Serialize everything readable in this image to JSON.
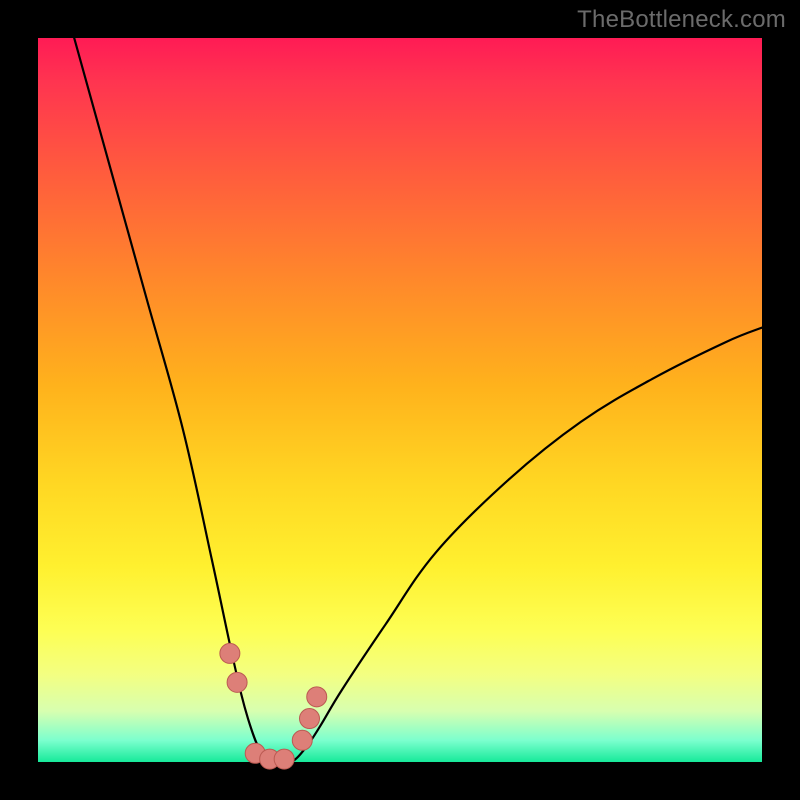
{
  "watermark": "TheBottleneck.com",
  "colors": {
    "background": "#000000",
    "curve": "#000000",
    "marker_fill": "#dd7f78",
    "marker_stroke": "#bb5a52"
  },
  "chart_data": {
    "type": "line",
    "title": "",
    "xlabel": "",
    "ylabel": "",
    "xlim": [
      0,
      100
    ],
    "ylim": [
      0,
      100
    ],
    "grid": false,
    "legend": false,
    "note": "V-shaped bottleneck curve. x = performance-ratio position (arbitrary 0–100). y = bottleneck percentage (0 = balanced, 100 = worst). Minimum bottleneck sits around x≈33. Values are read off the image; no numeric axes are shown so x is normalized.",
    "series": [
      {
        "name": "bottleneck-curve",
        "x": [
          5,
          10,
          15,
          20,
          24,
          27,
          29,
          31,
          33,
          35,
          37,
          39,
          42,
          48,
          55,
          65,
          75,
          85,
          95,
          100
        ],
        "y": [
          100,
          82,
          64,
          46,
          28,
          14,
          6,
          1,
          0,
          0,
          2,
          5,
          10,
          19,
          29,
          39,
          47,
          53,
          58,
          60
        ]
      }
    ],
    "markers": {
      "name": "highlighted-range",
      "x": [
        26.5,
        27.5,
        30,
        32,
        34,
        36.5,
        37.5,
        38.5
      ],
      "y": [
        15,
        11,
        1.2,
        0.4,
        0.4,
        3,
        6,
        9
      ]
    }
  }
}
